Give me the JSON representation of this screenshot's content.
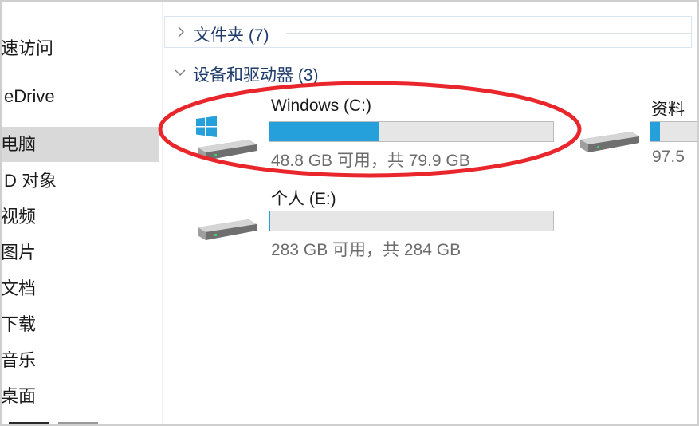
{
  "sidebar": {
    "items": [
      {
        "label": "速访问"
      },
      {
        "label": "eDrive"
      },
      {
        "label": "电脑"
      },
      {
        "label": "D 对象"
      },
      {
        "label": "视频"
      },
      {
        "label": "图片"
      },
      {
        "label": "文档"
      },
      {
        "label": "下载"
      },
      {
        "label": "音乐"
      },
      {
        "label": "桌面"
      }
    ]
  },
  "groups": {
    "folders": {
      "title": "文件夹 (7)",
      "expanded": false
    },
    "drives": {
      "title": "设备和驱动器 (3)",
      "expanded": true
    }
  },
  "drives": [
    {
      "name": "Windows (C:)",
      "info": "48.8 GB 可用，共 79.9 GB",
      "used_fraction": 0.389,
      "system_drive": true
    },
    {
      "name": "资料",
      "info": "97.5",
      "used_fraction": 0.2,
      "system_drive": false
    },
    {
      "name": "个人 (E:)",
      "info": "283 GB 可用，共 284 GB",
      "used_fraction": 0.004,
      "system_drive": false
    }
  ],
  "colors": {
    "accent_fill": "#26a0da",
    "annotation_ring": "#e8262b",
    "header_text": "#1f3d6b"
  }
}
